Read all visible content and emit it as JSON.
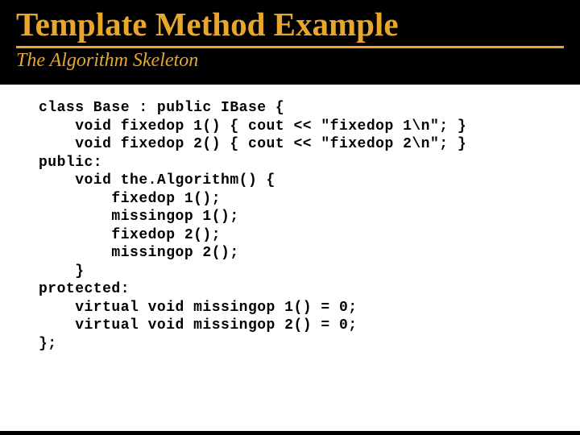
{
  "title": "Template Method Example",
  "subtitle": "The Algorithm Skeleton",
  "code": "class Base : public IBase {\n    void fixedop 1() { cout << \"fixedop 1\\n\"; }\n    void fixedop 2() { cout << \"fixedop 2\\n\"; }\npublic:\n    void the.Algorithm() {\n        fixedop 1();\n        missingop 1();\n        fixedop 2();\n        missingop 2();\n    }\nprotected:\n    virtual void missingop 1() = 0;\n    virtual void missingop 2() = 0;\n};"
}
